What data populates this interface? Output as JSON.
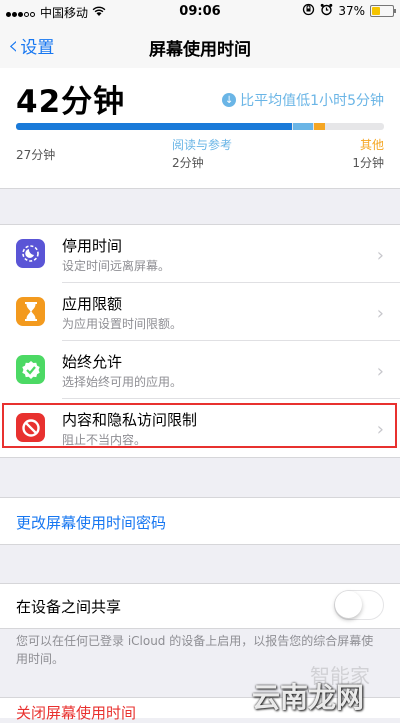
{
  "status_bar": {
    "carrier": "中国移动",
    "time": "09:06",
    "battery": "37%"
  },
  "nav": {
    "back_label": "设置",
    "title": "屏幕使用时间"
  },
  "usage": {
    "total": "42分钟",
    "comparison": "比平均值低1小时5分钟",
    "segments": [
      {
        "category": "",
        "time": "27分钟",
        "value": 27,
        "color": "#1a7ad9"
      },
      {
        "category": "阅读与参考",
        "time": "2分钟",
        "value": 2,
        "color": "#6ab5e6"
      },
      {
        "category": "其他",
        "time": "1分钟",
        "value": 1,
        "color": "#f5a623"
      }
    ]
  },
  "menu": [
    {
      "title": "停用时间",
      "subtitle": "设定时间远离屏幕。",
      "icon": "downtime-icon",
      "color": "#5a55d6"
    },
    {
      "title": "应用限额",
      "subtitle": "为应用设置时间限额。",
      "icon": "hourglass-icon",
      "color": "#f39a1e"
    },
    {
      "title": "始终允许",
      "subtitle": "选择始终可用的应用。",
      "icon": "checkmark-badge-icon",
      "color": "#4cd964"
    },
    {
      "title": "内容和隐私访问限制",
      "subtitle": "阻止不当内容。",
      "icon": "restriction-icon",
      "color": "#e8312f"
    }
  ],
  "change_passcode": "更改屏幕使用时间密码",
  "share": {
    "label": "在设备之间共享",
    "footnote": "您可以在任何已登录 iCloud 的设备上启用，以报告您的综合屏幕使用时间。"
  },
  "bottom_action": "关闭屏幕使用时间",
  "watermark": {
    "line1": "智能家",
    "line2": "云南龙网"
  }
}
